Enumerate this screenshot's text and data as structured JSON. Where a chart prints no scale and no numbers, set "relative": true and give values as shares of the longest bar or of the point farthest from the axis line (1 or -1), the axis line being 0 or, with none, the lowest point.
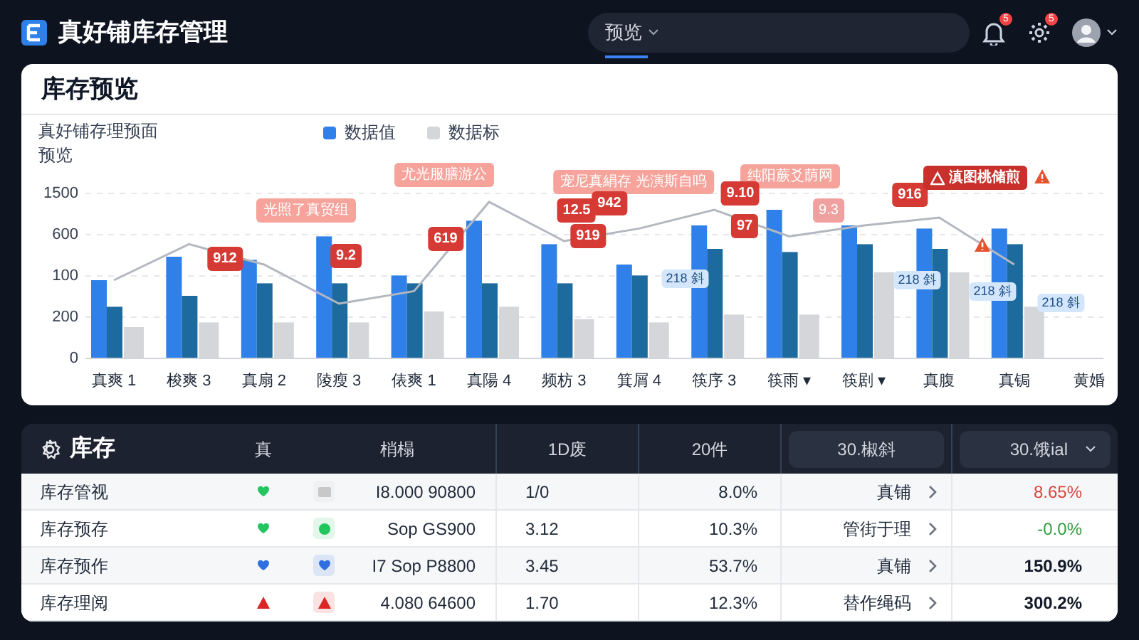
{
  "app": {
    "title": "真好铺库存管理"
  },
  "search": {
    "tabs": [
      {
        "label": "预览",
        "selected": true
      }
    ]
  },
  "header_icons": [
    {
      "kind": "bell",
      "badge": "5"
    },
    {
      "kind": "gear",
      "badge": "5"
    },
    {
      "kind": "avatar"
    }
  ],
  "overview": {
    "title": "库存预览",
    "subtitle": "真好铺存理预面",
    "subtitle_2": "预览",
    "y_axis_labels": [
      "1500",
      "600",
      "100",
      "200",
      "0"
    ],
    "chart_data": {
      "type": "bar",
      "relative": true,
      "categories": [
        "真爽 1",
        "梭爽 3",
        "真扇 2",
        "陵瘦 3",
        "俵爽 1",
        "真陽 4",
        "频枋 3",
        "箕屑 4",
        "筷序 3",
        "筷雨 ▾",
        "筷剧 ▾",
        "真腹",
        "真锔",
        "黄婚"
      ],
      "series": [
        {
          "name": "数据值",
          "color": "#2f80e8",
          "values": [
            0.5,
            0.65,
            0.63,
            0.78,
            0.53,
            0.88,
            0.73,
            0.6,
            0.85,
            0.95,
            0.85,
            0.83,
            0.83,
            null
          ]
        },
        {
          "color": "#1d6a9e",
          "values": [
            0.33,
            0.4,
            0.48,
            0.48,
            0.48,
            0.48,
            0.48,
            0.53,
            0.7,
            0.68,
            0.73,
            0.7,
            0.73,
            null
          ]
        },
        {
          "name": "数据标",
          "color": "#d4d6da",
          "values": [
            0.2,
            0.23,
            0.23,
            0.23,
            0.3,
            0.33,
            0.25,
            0.23,
            0.28,
            0.28,
            0.55,
            0.55,
            0.33,
            null
          ]
        },
        {
          "type": "line",
          "color": "#b3b7bf",
          "values": [
            0.5,
            0.73,
            0.6,
            0.35,
            0.43,
            1.0,
            0.75,
            0.83,
            0.95,
            0.78,
            0.85,
            0.9,
            0.6,
            null
          ]
        }
      ],
      "annotations": [
        "光照了真贸组",
        "尤光服膳游公",
        "912",
        "9.2",
        "619",
        "12.5",
        "919",
        "宠尼真絹存 光演斯自呜",
        "942",
        "纯阳蕨爻荫网",
        "9.10",
        "97",
        "9.3",
        "916",
        "滇图桃储煎",
        "218 斜",
        "218 斜",
        "218 斜",
        "218 斜"
      ]
    }
  },
  "table": {
    "title": "库存",
    "columns": [
      {
        "label": "真",
        "kind": "text"
      },
      {
        "label": "梢榻",
        "kind": "text"
      },
      {
        "label": "1D废",
        "kind": "text"
      },
      {
        "label": "20件",
        "kind": "text"
      },
      {
        "label": "30.椒斜",
        "kind": "button"
      },
      {
        "label": "30.饿ial",
        "kind": "dropdown"
      }
    ],
    "rows": [
      {
        "name": "库存管视",
        "status": {
          "kind": "heart",
          "color": "#22c55e"
        },
        "tag": {
          "kind": "square",
          "color": "#c8c8c8"
        },
        "code": "I8.000 90800",
        "col_1": "1/0",
        "col_2": "8.0%",
        "link": "真铺",
        "change": {
          "text": "8.65%",
          "color": "#d9453d"
        }
      },
      {
        "name": "库存预存",
        "status": {
          "kind": "heart",
          "color": "#22c55e"
        },
        "tag": {
          "kind": "dot",
          "color": "#22c55e"
        },
        "code": "Sop GS900",
        "col_1": "3.12",
        "col_2": "10.3%",
        "link": "管街于理",
        "change": {
          "text": "-0.0%",
          "color": "#2e9e3e"
        }
      },
      {
        "name": "库存预作",
        "status": {
          "kind": "heart",
          "color": "#2f6fe0"
        },
        "tag": {
          "kind": "heart",
          "color": "#2f6fe0"
        },
        "code": "I7 Sop P8800",
        "col_1": "3.45",
        "col_2": "53.7%",
        "link": "真铺",
        "change": {
          "text": "150.9%",
          "color": "#111827"
        }
      },
      {
        "name": "库存理阅",
        "status": {
          "kind": "triangle",
          "color": "#dc2626"
        },
        "tag": {
          "kind": "triangle",
          "color": "#dc2626"
        },
        "code": "4.080 64600",
        "col_1": "1.70",
        "col_2": "12.3%",
        "link": "替作绳码",
        "change": {
          "text": "300.2%",
          "color": "#111827"
        }
      }
    ]
  }
}
